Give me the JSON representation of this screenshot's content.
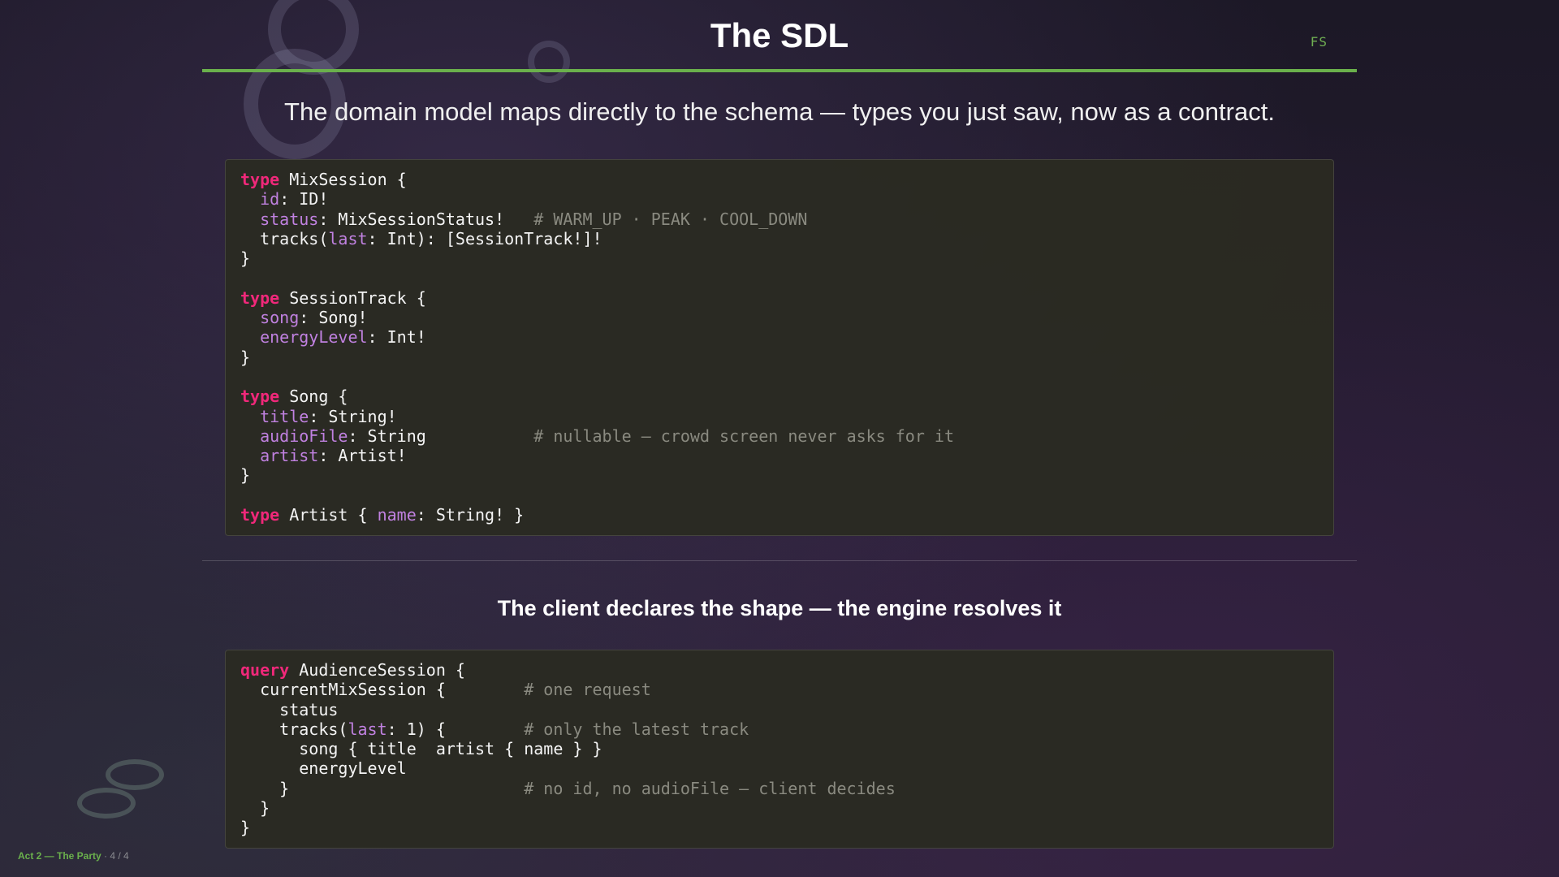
{
  "slide": {
    "title": "The SDL",
    "corner_tag": "FS",
    "subtitle": "The domain model maps directly to the schema — types you just saw, now as a contract.",
    "section_heading": "The client declares the shape — the engine resolves it"
  },
  "sdl": {
    "lines": [
      [
        [
          "kw",
          "type"
        ],
        [
          "txt",
          " MixSession {"
        ]
      ],
      [
        [
          "txt",
          "  "
        ],
        [
          "fld",
          "id"
        ],
        [
          "txt",
          ": ID!"
        ]
      ],
      [
        [
          "txt",
          "  "
        ],
        [
          "fld",
          "status"
        ],
        [
          "txt",
          ": MixSessionStatus!   "
        ],
        [
          "cmt",
          "# WARM_UP · PEAK · COOL_DOWN"
        ]
      ],
      [
        [
          "txt",
          "  tracks("
        ],
        [
          "fld",
          "last"
        ],
        [
          "txt",
          ": Int): [SessionTrack!]!"
        ]
      ],
      [
        [
          "txt",
          "}"
        ]
      ],
      [
        [
          "txt",
          ""
        ]
      ],
      [
        [
          "kw",
          "type"
        ],
        [
          "txt",
          " SessionTrack {"
        ]
      ],
      [
        [
          "txt",
          "  "
        ],
        [
          "fld",
          "song"
        ],
        [
          "txt",
          ": Song!"
        ]
      ],
      [
        [
          "txt",
          "  "
        ],
        [
          "fld",
          "energyLevel"
        ],
        [
          "txt",
          ": Int!"
        ]
      ],
      [
        [
          "txt",
          "}"
        ]
      ],
      [
        [
          "txt",
          ""
        ]
      ],
      [
        [
          "kw",
          "type"
        ],
        [
          "txt",
          " Song {"
        ]
      ],
      [
        [
          "txt",
          "  "
        ],
        [
          "fld",
          "title"
        ],
        [
          "txt",
          ": String!"
        ]
      ],
      [
        [
          "txt",
          "  "
        ],
        [
          "fld",
          "audioFile"
        ],
        [
          "txt",
          ": String           "
        ],
        [
          "cmt",
          "# nullable — crowd screen never asks for it"
        ]
      ],
      [
        [
          "txt",
          "  "
        ],
        [
          "fld",
          "artist"
        ],
        [
          "txt",
          ": Artist!"
        ]
      ],
      [
        [
          "txt",
          "}"
        ]
      ],
      [
        [
          "txt",
          ""
        ]
      ],
      [
        [
          "kw",
          "type"
        ],
        [
          "txt",
          " Artist { "
        ],
        [
          "fld",
          "name"
        ],
        [
          "txt",
          ": String! }"
        ]
      ]
    ]
  },
  "query": {
    "lines": [
      [
        [
          "kw",
          "query"
        ],
        [
          "txt",
          " AudienceSession {"
        ]
      ],
      [
        [
          "txt",
          "  currentMixSession {        "
        ],
        [
          "cmt",
          "# one request"
        ]
      ],
      [
        [
          "txt",
          "    status"
        ]
      ],
      [
        [
          "txt",
          "    tracks("
        ],
        [
          "fld",
          "last"
        ],
        [
          "txt",
          ": 1) {        "
        ],
        [
          "cmt",
          "# only the latest track"
        ]
      ],
      [
        [
          "txt",
          "      song { title  artist { name } }"
        ]
      ],
      [
        [
          "txt",
          "      energyLevel"
        ]
      ],
      [
        [
          "txt",
          "    }                        "
        ],
        [
          "cmt",
          "# no id, no audioFile — client decides"
        ]
      ],
      [
        [
          "txt",
          "  }"
        ]
      ],
      [
        [
          "txt",
          "}"
        ]
      ]
    ]
  },
  "footer": {
    "act": "Act 2 — The Party",
    "progress": "· 4 / 4"
  }
}
